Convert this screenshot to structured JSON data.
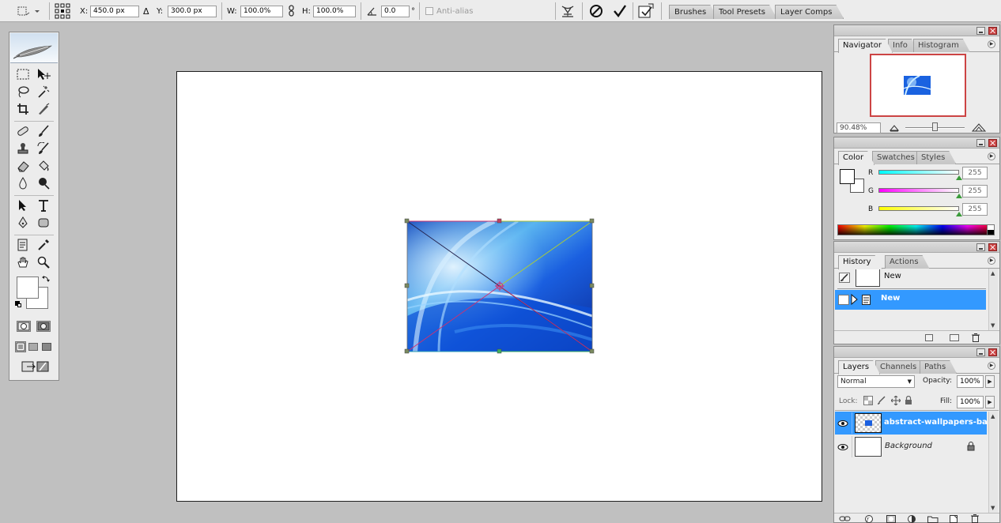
{
  "options_bar": {
    "x_label": "X:",
    "x_value": "450.0 px",
    "y_label": "Y:",
    "y_value": "300.0 px",
    "w_label": "W:",
    "w_value": "100.0%",
    "h_label": "H:",
    "h_value": "100.0%",
    "angle_value": "0.0",
    "degree_symbol": "°",
    "antialias_label": "Anti-alias",
    "well_tabs": [
      "Brushes",
      "Tool Presets",
      "Layer Comps"
    ]
  },
  "navigator": {
    "tabs": [
      "Navigator",
      "Info",
      "Histogram"
    ],
    "zoom": "90.48%"
  },
  "color": {
    "tabs": [
      "Color",
      "Swatches",
      "Styles"
    ],
    "channels": [
      {
        "label": "R",
        "value": "255"
      },
      {
        "label": "G",
        "value": "255"
      },
      {
        "label": "B",
        "value": "255"
      }
    ]
  },
  "history": {
    "tabs": [
      "History",
      "Actions"
    ],
    "snapshot_label": "New",
    "items": [
      "New"
    ]
  },
  "layers": {
    "tabs": [
      "Layers",
      "Channels",
      "Paths"
    ],
    "blend_mode": "Normal",
    "opacity_label": "Opacity:",
    "opacity_value": "100%",
    "lock_label": "Lock:",
    "fill_label": "Fill:",
    "fill_value": "100%",
    "items": [
      {
        "name": "abstract-wallpapers-ba..."
      },
      {
        "name": "Background"
      }
    ]
  }
}
